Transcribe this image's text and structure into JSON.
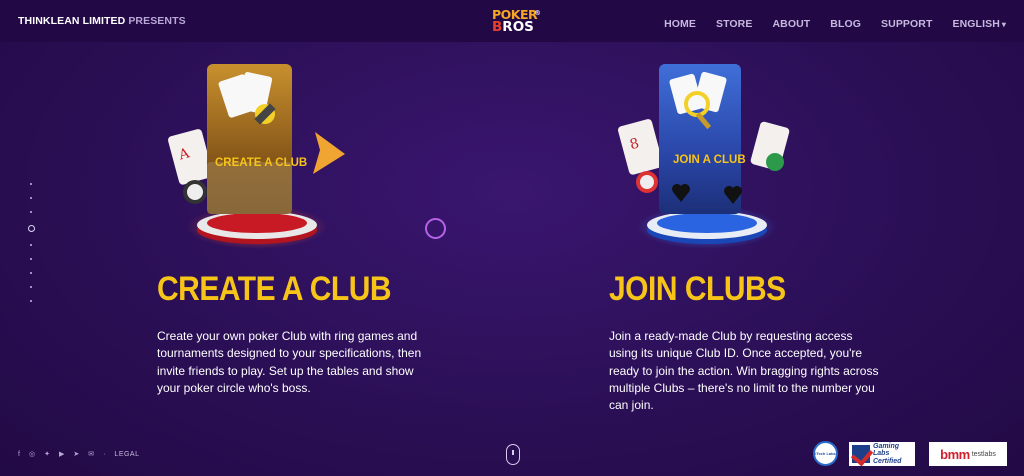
{
  "header": {
    "presenter_brand": "THINKLEAN LIMITED",
    "presenter_suffix": "PRESENTS",
    "logo_line1": "POKER",
    "logo_line2_b": "B",
    "logo_line2_rest": "ROS",
    "logo_reg": "®",
    "nav": [
      {
        "label": "HOME"
      },
      {
        "label": "STORE"
      },
      {
        "label": "ABOUT"
      },
      {
        "label": "BLOG"
      },
      {
        "label": "SUPPORT"
      },
      {
        "label": "ENGLISH",
        "caret": "▾"
      }
    ]
  },
  "sections": {
    "create": {
      "card_label": "CREATE A CLUB",
      "title": "CREATE A CLUB",
      "text": "Create your own poker Club with ring games and tournaments designed to your specifications, then invite friends to play. Set up the tables and show your poker circle who's boss."
    },
    "join": {
      "card_label": "JOIN A CLUB",
      "title": "JOIN CLUBS",
      "text": "Join a ready-made Club by requesting access using its unique Club ID. Once accepted, you're ready to join the action. Win bragging rights across multiple Clubs – there's no limit to the number you can join."
    }
  },
  "footer": {
    "social_icons": [
      "facebook-icon",
      "instagram-icon",
      "twitter-icon",
      "youtube-icon",
      "telegram-icon",
      "mail-icon"
    ],
    "separator": "·",
    "legal": "LEGAL",
    "badges": {
      "itech": "iTech Labs",
      "gli_line1": "Gaming",
      "gli_line2": "Labs",
      "gli_line3": "Certified",
      "bmm_main": "bmm",
      "bmm_sub": "testlabs"
    }
  },
  "colors": {
    "background": "#2b0f56",
    "header": "#230846",
    "title_yellow": "#f7c418",
    "ring_purple": "#b564e8"
  }
}
